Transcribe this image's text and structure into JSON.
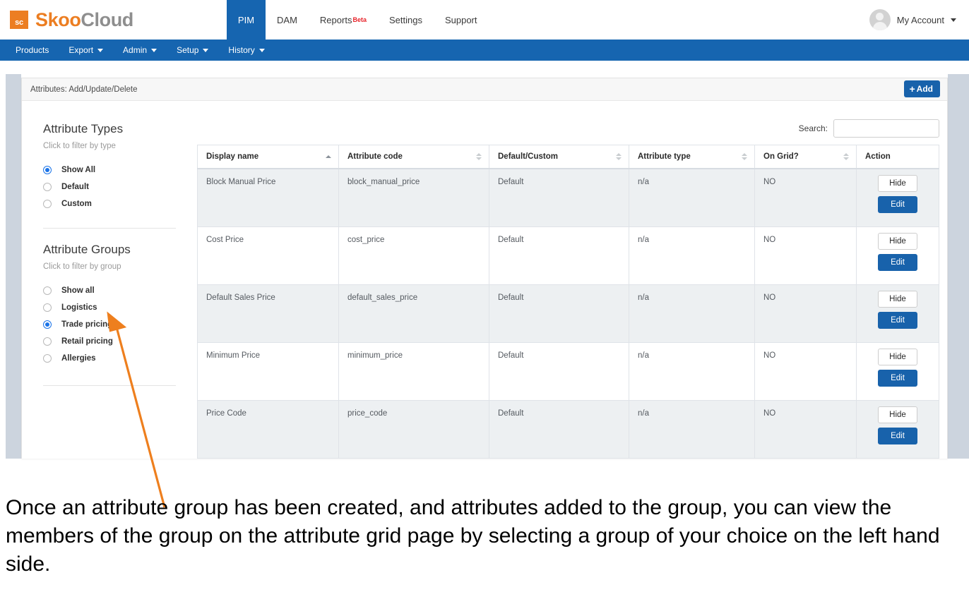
{
  "brand": {
    "badge": "sc",
    "name_part1": "Skoo",
    "name_part2": "Cloud",
    "accent_color": "#ec7e22",
    "secondary_color": "#8e8e8e"
  },
  "topnav": {
    "tabs": [
      {
        "label": "PIM",
        "active": true,
        "badge": ""
      },
      {
        "label": "DAM",
        "active": false,
        "badge": ""
      },
      {
        "label": "Reports",
        "active": false,
        "badge": "Beta"
      },
      {
        "label": "Settings",
        "active": false,
        "badge": ""
      },
      {
        "label": "Support",
        "active": false,
        "badge": ""
      }
    ],
    "active_color": "#1665b0",
    "badge_color": "#e8242b"
  },
  "account": {
    "label": "My Account"
  },
  "menubar": {
    "background": "#1665b0",
    "items": [
      {
        "label": "Products",
        "has_caret": false
      },
      {
        "label": "Export",
        "has_caret": true
      },
      {
        "label": "Admin",
        "has_caret": true
      },
      {
        "label": "Setup",
        "has_caret": true
      },
      {
        "label": "History",
        "has_caret": true
      }
    ]
  },
  "card": {
    "title": "Attributes: Add/Update/Delete",
    "add_label": "Add",
    "add_plus": "+",
    "add_color": "#1862ab"
  },
  "filters": {
    "types": {
      "title": "Attribute Types",
      "subtitle": "Click to filter by type",
      "options": [
        {
          "label": "Show All",
          "selected": true
        },
        {
          "label": "Default",
          "selected": false
        },
        {
          "label": "Custom",
          "selected": false
        }
      ]
    },
    "groups": {
      "title": "Attribute Groups",
      "subtitle": "Click to filter by group",
      "options": [
        {
          "label": "Show all",
          "selected": false
        },
        {
          "label": "Logistics",
          "selected": false
        },
        {
          "label": "Trade pricing",
          "selected": true
        },
        {
          "label": "Retail pricing",
          "selected": false
        },
        {
          "label": "Allergies",
          "selected": false
        }
      ]
    }
  },
  "search": {
    "label": "Search:",
    "value": "",
    "placeholder": ""
  },
  "table": {
    "columns": [
      {
        "label": "Display name",
        "sort": "asc"
      },
      {
        "label": "Attribute code",
        "sort": "none"
      },
      {
        "label": "Default/Custom",
        "sort": "none"
      },
      {
        "label": "Attribute type",
        "sort": "none"
      },
      {
        "label": "On Grid?",
        "sort": "none"
      },
      {
        "label": "Action",
        "sort": "off"
      }
    ],
    "rows": [
      {
        "display_name": "Block Manual Price",
        "attribute_code": "block_manual_price",
        "default_custom": "Default",
        "attribute_type": "n/a",
        "on_grid": "NO",
        "hide_label": "Hide",
        "edit_label": "Edit"
      },
      {
        "display_name": "Cost Price",
        "attribute_code": "cost_price",
        "default_custom": "Default",
        "attribute_type": "n/a",
        "on_grid": "NO",
        "hide_label": "Hide",
        "edit_label": "Edit"
      },
      {
        "display_name": "Default Sales Price",
        "attribute_code": "default_sales_price",
        "default_custom": "Default",
        "attribute_type": "n/a",
        "on_grid": "NO",
        "hide_label": "Hide",
        "edit_label": "Edit"
      },
      {
        "display_name": "Minimum Price",
        "attribute_code": "minimum_price",
        "default_custom": "Default",
        "attribute_type": "n/a",
        "on_grid": "NO",
        "hide_label": "Hide",
        "edit_label": "Edit"
      },
      {
        "display_name": "Price Code",
        "attribute_code": "price_code",
        "default_custom": "Default",
        "attribute_type": "n/a",
        "on_grid": "NO",
        "hide_label": "Hide",
        "edit_label": "Edit"
      }
    ]
  },
  "annotation": {
    "arrow_color": "#ee7f1e",
    "caption": "Once an attribute group has been created, and attributes added to the group, you can view the members of the group on the attribute grid page by selecting a group of your choice on the left hand side."
  }
}
